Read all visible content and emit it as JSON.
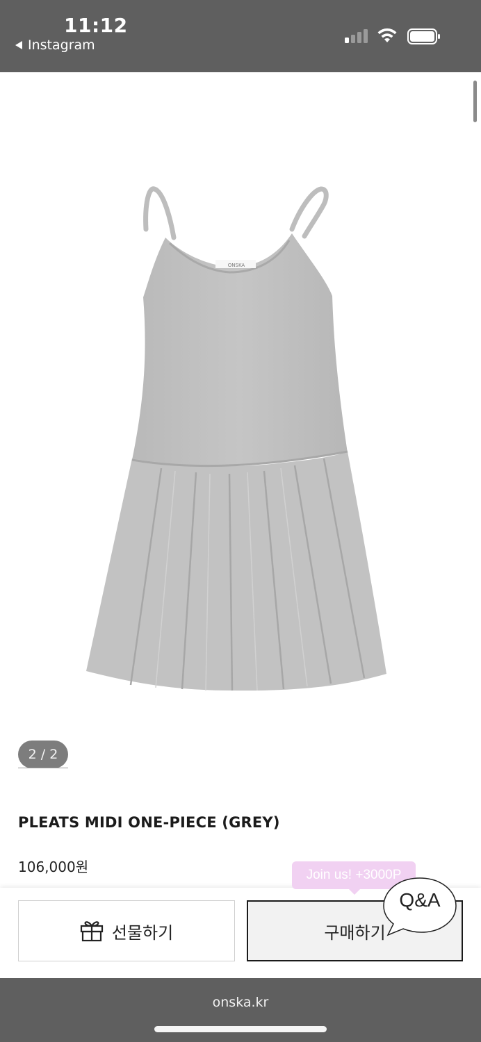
{
  "status_bar": {
    "time": "11:12",
    "back_app": "Instagram",
    "icons": [
      "signal-icon",
      "wifi-icon",
      "battery-icon"
    ]
  },
  "product": {
    "image_icon": "grey-pleated-dress-image",
    "pager": "2 / 2",
    "title": "PLEATS MIDI ONE-PIECE (GREY)",
    "price": "106,000원",
    "tag_text": "ONSKA"
  },
  "promo": {
    "join_badge": "Join us! +3000P",
    "color": "#f1d1f2"
  },
  "actions": {
    "gift_label": "선물하기",
    "gift_icon": "gift-icon",
    "buy_label": "구매하기",
    "qa_label": "Q&A"
  },
  "browser": {
    "domain": "onska.kr"
  }
}
